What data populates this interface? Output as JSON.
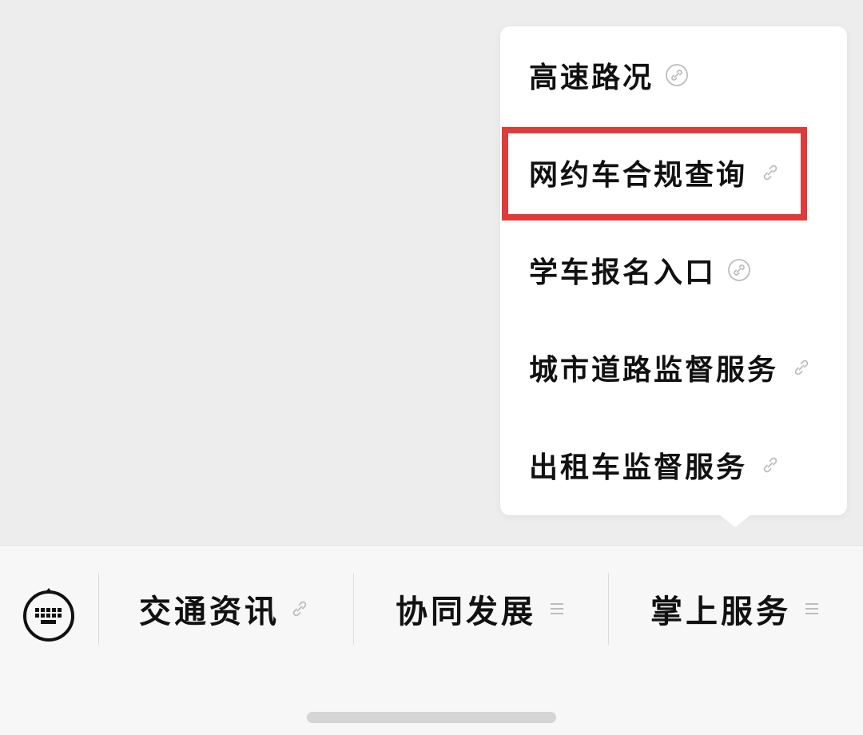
{
  "popup_menu": {
    "items": [
      {
        "label": "高速路况",
        "icon": "link-icon"
      },
      {
        "label": "网约车合规查询",
        "icon": "link-icon",
        "highlighted": true
      },
      {
        "label": "学车报名入口",
        "icon": "link-icon"
      },
      {
        "label": "城市道路监督服务",
        "icon": "link-icon"
      },
      {
        "label": "出租车监督服务",
        "icon": "link-icon"
      }
    ]
  },
  "bottom_bar": {
    "keyboard_icon": "keyboard-icon",
    "menus": [
      {
        "label": "交通资讯",
        "icon": "link-icon"
      },
      {
        "label": "协同发展",
        "icon": "list-icon"
      },
      {
        "label": "掌上服务",
        "icon": "list-icon"
      }
    ]
  },
  "colors": {
    "highlight": "#e03a3a",
    "background": "#ededed",
    "menu_background": "#ffffff",
    "text": "#111111"
  }
}
